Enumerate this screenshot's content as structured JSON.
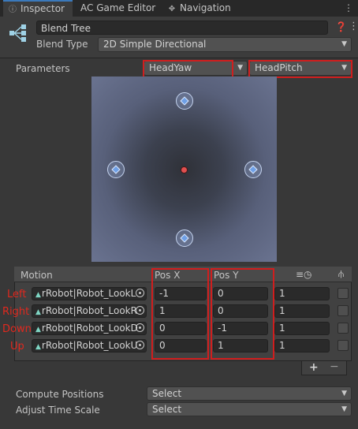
{
  "tabs": [
    {
      "label": "Inspector",
      "icon": "info-icon",
      "active": true
    },
    {
      "label": "AC Game Editor",
      "icon": "",
      "active": false
    },
    {
      "label": "Navigation",
      "icon": "navigation-icon",
      "active": false
    }
  ],
  "header": {
    "name_value": "Blend Tree",
    "blend_type_label": "Blend Type",
    "blend_type_value": "2D Simple Directional"
  },
  "parameters": {
    "label": "Parameters",
    "param_x": "HeadYaw",
    "param_y": "HeadPitch"
  },
  "table": {
    "headers": {
      "motion": "Motion",
      "pos_x": "Pos X",
      "pos_y": "Pos Y"
    },
    "rows": [
      {
        "label": "Left",
        "clip": "rRobot|Robot_LookL",
        "pos_x": "-1",
        "pos_y": "0",
        "speed": "1"
      },
      {
        "label": "Right",
        "clip": "rRobot|Robot_LookR",
        "pos_x": "1",
        "pos_y": "0",
        "speed": "1"
      },
      {
        "label": "Down",
        "clip": "rRobot|Robot_LookD",
        "pos_x": "0",
        "pos_y": "-1",
        "speed": "1"
      },
      {
        "label": "Up",
        "clip": "rRobot|Robot_LookU",
        "pos_x": "0",
        "pos_y": "1",
        "speed": "1"
      }
    ],
    "add_label": "+",
    "remove_label": "−"
  },
  "footer": {
    "compute_label": "Compute Positions",
    "compute_value": "Select",
    "adjust_label": "Adjust Time Scale",
    "adjust_value": "Select"
  },
  "colors": {
    "accent": "#3a79bb",
    "highlight": "#d01e1e",
    "label_red": "#e0281e"
  }
}
